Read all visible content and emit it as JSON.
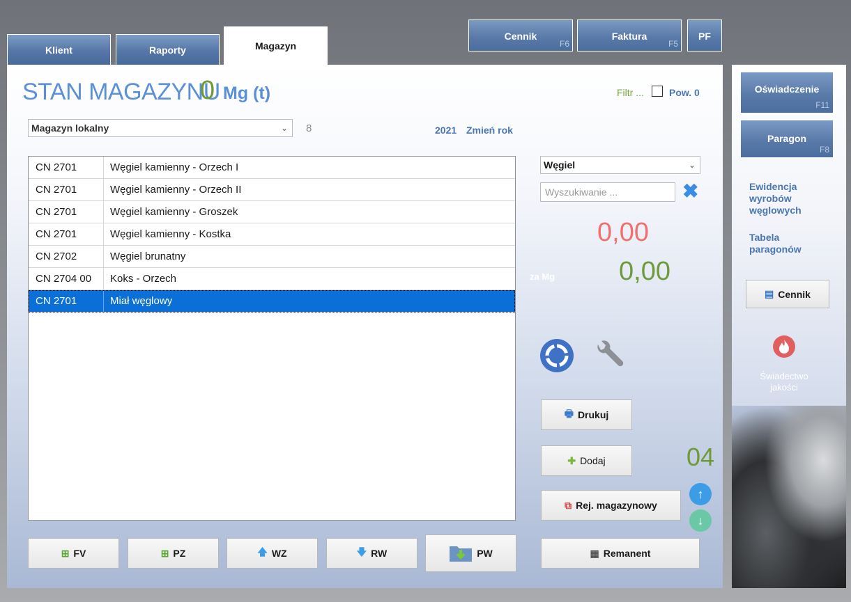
{
  "tabs": [
    {
      "label": "Klient",
      "active": false
    },
    {
      "label": "Raporty",
      "active": false
    },
    {
      "label": "Magazyn",
      "active": true
    }
  ],
  "fkeys": {
    "cennik": {
      "label": "Cennik",
      "key": "F6"
    },
    "faktura": {
      "label": "Faktura",
      "key": "F5"
    },
    "pf": {
      "label": "PF"
    }
  },
  "header": {
    "title": "STAN MAGAZYNU",
    "quantity": "0",
    "unit": "Mg (t)",
    "filter_label": "Filtr ...",
    "pow_label": "Pow. 0"
  },
  "warehouse": {
    "selected": "Magazyn lokalny",
    "count": "8",
    "year": "2021",
    "change_year": "Zmień rok"
  },
  "products": [
    {
      "code": "CN 2701",
      "name": "Węgiel kamienny - Orzech I",
      "selected": false
    },
    {
      "code": "CN 2701",
      "name": "Węgiel kamienny - Orzech II",
      "selected": false
    },
    {
      "code": "CN 2701",
      "name": "Węgiel kamienny - Groszek",
      "selected": false
    },
    {
      "code": "CN 2701",
      "name": "Węgiel kamienny - Kostka",
      "selected": false
    },
    {
      "code": "CN 2702",
      "name": "Węgiel brunatny",
      "selected": false
    },
    {
      "code": "CN 2704 00",
      "name": "Koks - Orzech",
      "selected": false
    },
    {
      "code": "CN 2701",
      "name": "Miał węglowy",
      "selected": true
    }
  ],
  "category_select": "Węgiel",
  "search": {
    "placeholder": "Wyszukiwanie ...",
    "value": ""
  },
  "amounts": {
    "value1": "0,00",
    "per_mg_label": "za Mg",
    "value2": "0,00"
  },
  "actions": {
    "drukuj": "Drukuj",
    "dodaj": "Dodaj",
    "rej": "Rej. magazynowy",
    "remanent": "Remanent",
    "counter": "04"
  },
  "bottom_buttons": {
    "fv": "FV",
    "pz": "PZ",
    "wz": "WZ",
    "rw": "RW",
    "pw": "PW"
  },
  "right_panel": {
    "oswiadczenie": {
      "label": "Oświadczenie",
      "key": "F11"
    },
    "paragon": {
      "label": "Paragon",
      "key": "F8"
    },
    "link1_l1": "Ewidencja",
    "link1_l2": "wyrobów",
    "link1_l3": "węglowych",
    "link2_l1": "Tabela",
    "link2_l2": "paragonów",
    "cennik": "Cennik",
    "swiad_l1": "Świadectwo",
    "swiad_l2": "jakości"
  },
  "colors": {
    "accent_blue": "#5b8fd6",
    "green": "#6f9a3c",
    "red": "#f07070",
    "selection": "#0a6fd6"
  }
}
